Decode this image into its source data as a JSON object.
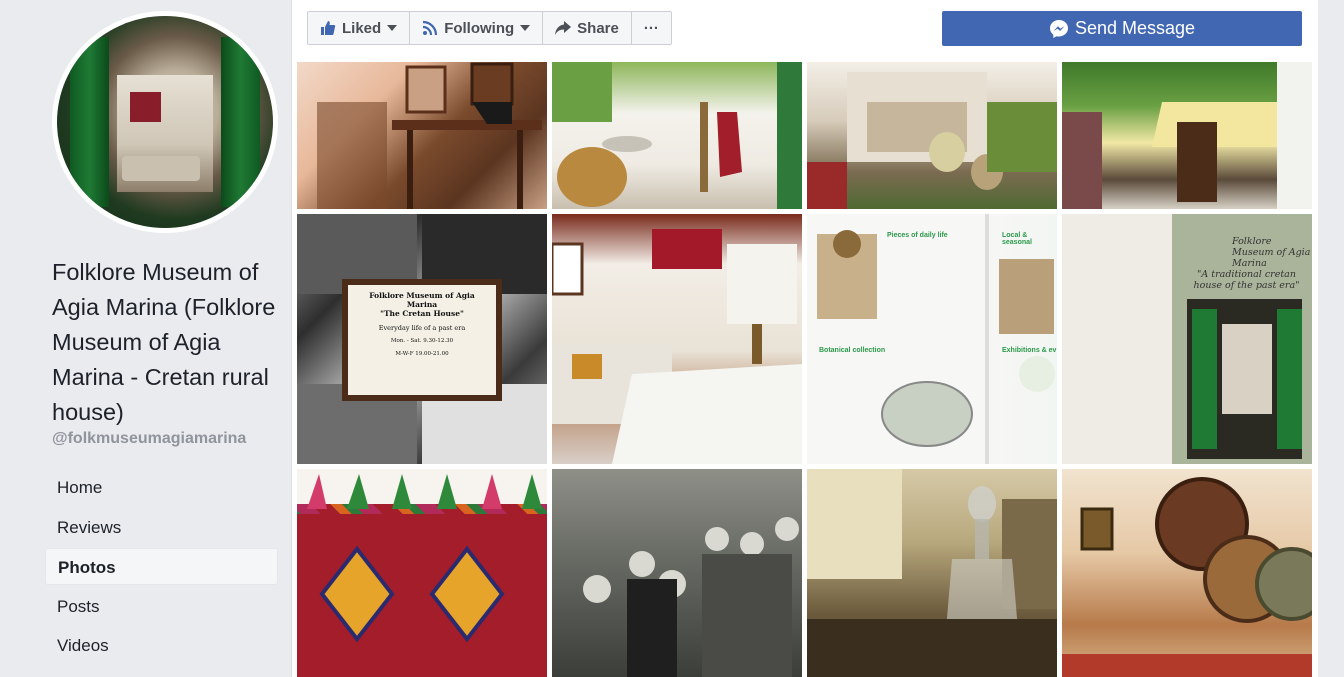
{
  "page": {
    "name": "Folklore Museum of Agia Marina (Folklore Museum of Agia Marina - Cretan rural house)",
    "handle": "@folkmuseumagiamarina"
  },
  "nav": [
    {
      "label": "Home",
      "active": false
    },
    {
      "label": "Reviews",
      "active": false
    },
    {
      "label": "Photos",
      "active": true
    },
    {
      "label": "Posts",
      "active": false
    },
    {
      "label": "Videos",
      "active": false
    }
  ],
  "actions": {
    "liked": "Liked",
    "following": "Following",
    "share": "Share",
    "more": "···",
    "send_message": "Send Message"
  },
  "poster": {
    "title": "Folklore Museum of Agia Marina",
    "subtitle": "\"The Cretan House\"",
    "tagline": "Everyday life of a past era",
    "hours1": "Mon. - Sat. 9.30-12.30",
    "hours2": "M-W-F 19.00-21.00"
  },
  "brochure": {
    "h1": "Pieces of daily life",
    "h2": "Local & seasonal",
    "h3": "Botanical collection",
    "h4": "Exhibitions & ev",
    "script1": "Folklore Museum of Agia Marina",
    "script2": "\"A traditional cretan house of the past era\""
  },
  "colors": {
    "brand_blue": "#4267b2",
    "page_bg": "#e9ebee",
    "handle_gray": "#90949c"
  }
}
